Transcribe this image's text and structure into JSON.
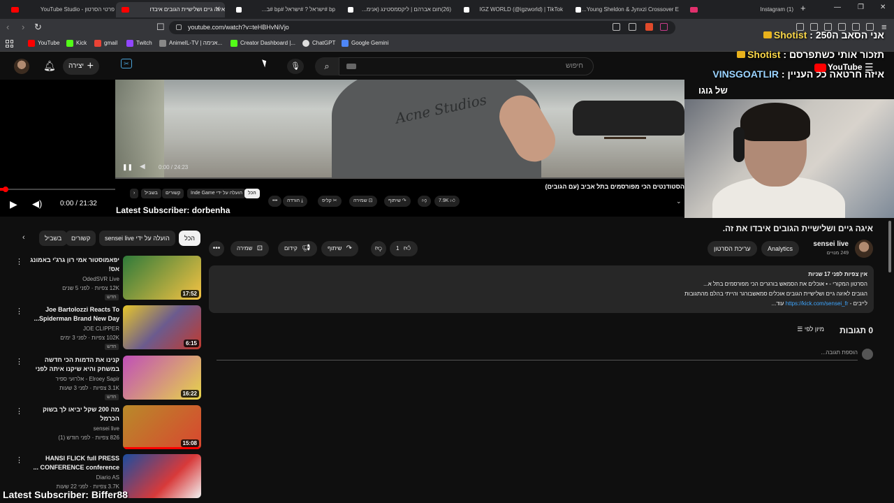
{
  "browser": {
    "tabs": [
      {
        "label": "פרטי הסרטון - YouTube Studio",
        "icon_color": "#ff0000"
      },
      {
        "label": "איגה גיים ושלישיית הגובים איבדו",
        "icon_color": "#ff0000",
        "active": true
      },
      {
        "label": "bp #ישראל ? #ישראל #bp #ב...",
        "icon_color": "#ffffff"
      },
      {
        "label": "(26)חום אברהם | ליקסמסטינג (אנימ...",
        "icon_color": "#ffffff"
      },
      {
        "label": "IGZ WORLD (@igzworld) | TikTok",
        "icon_color": "#ffffff"
      },
      {
        "label": "Young Sheldon & Jynxzi Crossover E...",
        "icon_color": "#ffffff"
      },
      {
        "label": "(1) Instagram",
        "icon_color": "#e1306c"
      }
    ],
    "url": "youtube.com/watch?v=teHBHvNiVjo",
    "bookmarks": [
      {
        "label": "YouTube",
        "color": "#ff0000"
      },
      {
        "label": "Kick",
        "color": "#53fc18"
      },
      {
        "label": "gmail",
        "color": "#ea4335"
      },
      {
        "label": "Twitch",
        "color": "#9146ff"
      },
      {
        "label": "AnimeIL-TV | אנימה...",
        "color": "#888888"
      },
      {
        "label": "Creator Dashboard |...",
        "color": "#53fc18"
      },
      {
        "label": "ChatGPT",
        "color": "#dddddd"
      },
      {
        "label": "Google Gemini",
        "color": "#4e86f7"
      }
    ]
  },
  "yt": {
    "search_placeholder": "חיפוש",
    "create_label": "יצירה"
  },
  "player": {
    "inner_time": "0:00 / 24:23",
    "main_time": "0:00 / 21:32",
    "inner_title": "הסטודנטים הכי מפורסמים בתל אביב (עם הגובים)",
    "inner_chips": [
      "הכל",
      "הועלה על ידי Inde Game",
      "קשורים",
      "בשביל"
    ],
    "inner_actions": [
      "7.9K",
      "שיתוף",
      "שמירה",
      "קליפ",
      "הורדה"
    ],
    "brand_text": "Acne Studios"
  },
  "overlay": {
    "chat": [
      {
        "name": "Shotist",
        "text": "אני הסאב ה250",
        "color": "#f9d648"
      },
      {
        "name": "Shotist",
        "text": "תזכור אותי כשתפרסם",
        "color": "#f9d648"
      },
      {
        "name": "VINSGOATLIR",
        "text": "איזה חרטאה כל העניין",
        "color": "#9ad3ff"
      }
    ],
    "cam_caption": "של גוגו",
    "yt_logo_text": "YouTube",
    "latest_top": "Latest Subscriber: dorbenha",
    "latest_bottom": "Latest Subscriber: Biffer88"
  },
  "sidebar": {
    "chips": [
      "הכל",
      "הועלה על ידי sensei live",
      "קשורים",
      "בשביל"
    ],
    "recs": [
      {
        "title": "יפאמוסטור אמי רון גרג'י באמונג אס!",
        "channel": "OdedSVR Live",
        "meta": "12K צפיות · לפני 5 שנים",
        "badge": "חדש",
        "duration": "17:52",
        "thumb": "#2f7a3a",
        "progress": 0
      },
      {
        "title": "Joe Bartolozzi Reacts To Spiderman Brand New Day...",
        "channel": "JOE CLIPPER",
        "meta": "102K צפיות · לפני 3 ימים",
        "badge": "חדש",
        "duration": "6:15",
        "thumb": "#6b5b8e",
        "progress": 0
      },
      {
        "title": "קנינו את הדמות הכי חדשה במשחק והיא שיקנו איתה לפני כולם ?! (נאג'ה)",
        "channel": "Elroey Sapir - אלרועי ספיר",
        "meta": "3.1K צפיות · לפני 3 שעות",
        "badge": "חדש",
        "duration": "16:22",
        "thumb": "#c04fb8",
        "progress": 0
      },
      {
        "title": "מה 200 שקל יביאו לך בשוק הכרמל",
        "channel": "sensei live",
        "meta": "826 צפיות · לפני חודש (1)",
        "badge": "",
        "duration": "15:08",
        "thumb": "#b88a2a",
        "progress": 100
      },
      {
        "title": "HANSI FLICK full PRESS CONFERENCE conference ...",
        "channel": "Diario AS",
        "meta": "3.7K צפיות · לפני 22 שעות",
        "badge": "",
        "duration": "",
        "thumb": "#1b4da0",
        "progress": 0
      }
    ]
  },
  "video": {
    "title": "איגה גיים ושלישיית הגובים איבדו את זה.",
    "channel": "sensei live",
    "subscribers": "249 מנויים",
    "analytics_label": "Analytics",
    "edit_label": "עריכת הסרטון",
    "likes": "1",
    "share_label": "שיתוף",
    "promote_label": "קידום",
    "save_label": "שמירה",
    "desc_line1": "אין צפיות  לפני 17 שניות",
    "desc_line2": "הסרטון המקורי - • אוכלים את הסמאש בורגרים הכי מפורסמים בתל א...",
    "desc_line3": "הגובים לאיגה גיים ושלישיית הגובים אוכלים סמאשבורגר והייתי בהלם מהתגובות",
    "desc_link": "https://kick.com/sensei_fr",
    "desc_line4_prefix": "לייבים - ",
    "desc_more": "עוד...",
    "comments_count": "0 תגובות",
    "sort_label": "מיון לפי",
    "add_comment": "הוספת תגובה..."
  }
}
